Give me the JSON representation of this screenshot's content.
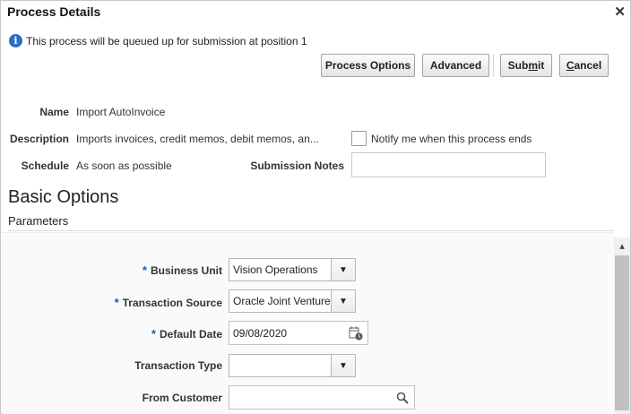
{
  "dialog": {
    "title": "Process Details",
    "close_symbol": "✕"
  },
  "info": {
    "icon": "info-icon",
    "text": "This process will be queued up for submission at position 1"
  },
  "buttons": {
    "process_options": "Process Options",
    "advanced": "Advanced",
    "submit_pre": "Sub",
    "submit_key": "m",
    "submit_post": "it",
    "cancel_key": "C",
    "cancel_post": "ancel"
  },
  "details": {
    "name_label": "Name",
    "name_value": "Import AutoInvoice",
    "description_label": "Description",
    "description_value": "Imports invoices, credit memos, debit memos, an...",
    "schedule_label": "Schedule",
    "schedule_value": "As soon as possible",
    "notify_label": "Notify me when this process ends",
    "notify_checked": false,
    "submission_notes_label": "Submission Notes",
    "submission_notes_value": ""
  },
  "basic_options": {
    "title": "Basic Options",
    "parameters_label": "Parameters",
    "required_marker": "*",
    "fields": {
      "business_unit_label": "Business Unit",
      "business_unit_value": "Vision Operations",
      "transaction_source_label": "Transaction Source",
      "transaction_source_value": "Oracle Joint Venture",
      "default_date_label": "Default Date",
      "default_date_value": "09/08/2020",
      "transaction_type_label": "Transaction Type",
      "transaction_type_value": "",
      "from_customer_label": "From Customer",
      "from_customer_value": ""
    }
  },
  "icons": {
    "dropdown": "chevron-down-icon",
    "calendar": "calendar-icon",
    "search": "search-icon",
    "scroll_up": "scroll-up-icon"
  },
  "colors": {
    "required_star": "#1f5aa6",
    "info_icon": "#2b6fc2"
  }
}
